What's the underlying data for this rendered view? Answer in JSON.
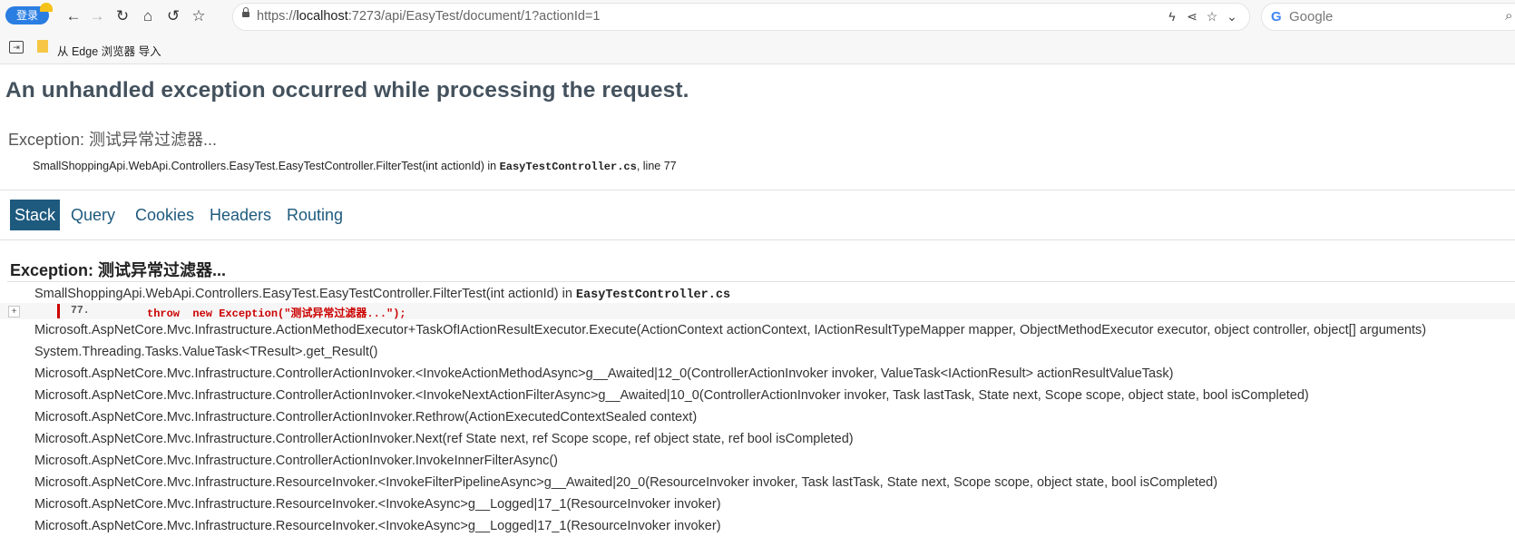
{
  "browser": {
    "profile_label": "登录",
    "url_scheme": "https://",
    "url_host": "localhost",
    "url_rest": ":7273/api/EasyTest/document/1?actionId=1",
    "search_engine": "Google",
    "favorites_bar": {
      "item_label": "从 Edge 浏览器 导入"
    }
  },
  "error_page": {
    "title": "An unhandled exception occurred while processing the request.",
    "exception_type": "Exception: 测试异常过滤器...",
    "location_method": "SmallShoppingApi.WebApi.Controllers.EasyTest.EasyTestController.FilterTest(int actionId) in ",
    "location_file": "EasyTestController.cs",
    "location_line": ", line 77",
    "tabs": [
      "Stack",
      "Query",
      "Cookies",
      "Headers",
      "Routing"
    ],
    "active_tab": "Stack",
    "stack_heading": "Exception: 测试异常过滤器...",
    "first_frame": {
      "method": "SmallShoppingApi.WebApi.Controllers.EasyTest.EasyTestController.FilterTest(int actionId) in ",
      "file": "EasyTestController.cs",
      "expand_symbol": "+",
      "line_number": "77.",
      "code": "throw  new Exception(\"测试异常过滤器...\");"
    },
    "frames": [
      "Microsoft.AspNetCore.Mvc.Infrastructure.ActionMethodExecutor+TaskOfIActionResultExecutor.Execute(ActionContext actionContext, IActionResultTypeMapper mapper, ObjectMethodExecutor executor, object controller, object[] arguments)",
      "System.Threading.Tasks.ValueTask<TResult>.get_Result()",
      "Microsoft.AspNetCore.Mvc.Infrastructure.ControllerActionInvoker.<InvokeActionMethodAsync>g__Awaited|12_0(ControllerActionInvoker invoker, ValueTask<IActionResult> actionResultValueTask)",
      "Microsoft.AspNetCore.Mvc.Infrastructure.ControllerActionInvoker.<InvokeNextActionFilterAsync>g__Awaited|10_0(ControllerActionInvoker invoker, Task lastTask, State next, Scope scope, object state, bool isCompleted)",
      "Microsoft.AspNetCore.Mvc.Infrastructure.ControllerActionInvoker.Rethrow(ActionExecutedContextSealed context)",
      "Microsoft.AspNetCore.Mvc.Infrastructure.ControllerActionInvoker.Next(ref State next, ref Scope scope, ref object state, ref bool isCompleted)",
      "Microsoft.AspNetCore.Mvc.Infrastructure.ControllerActionInvoker.InvokeInnerFilterAsync()",
      "Microsoft.AspNetCore.Mvc.Infrastructure.ResourceInvoker.<InvokeFilterPipelineAsync>g__Awaited|20_0(ResourceInvoker invoker, Task lastTask, State next, Scope scope, object state, bool isCompleted)",
      "Microsoft.AspNetCore.Mvc.Infrastructure.ResourceInvoker.<InvokeAsync>g__Logged|17_1(ResourceInvoker invoker)",
      "Microsoft.AspNetCore.Mvc.Infrastructure.ResourceInvoker.<InvokeAsync>g__Logged|17_1(ResourceInvoker invoker)"
    ]
  },
  "colors": {
    "title": "#44525e",
    "tab_link": "#1e5a7e",
    "tab_active_bg": "#1e5a7e",
    "code_highlight": "#cc0000",
    "profile_button": "#2a7ee2"
  }
}
